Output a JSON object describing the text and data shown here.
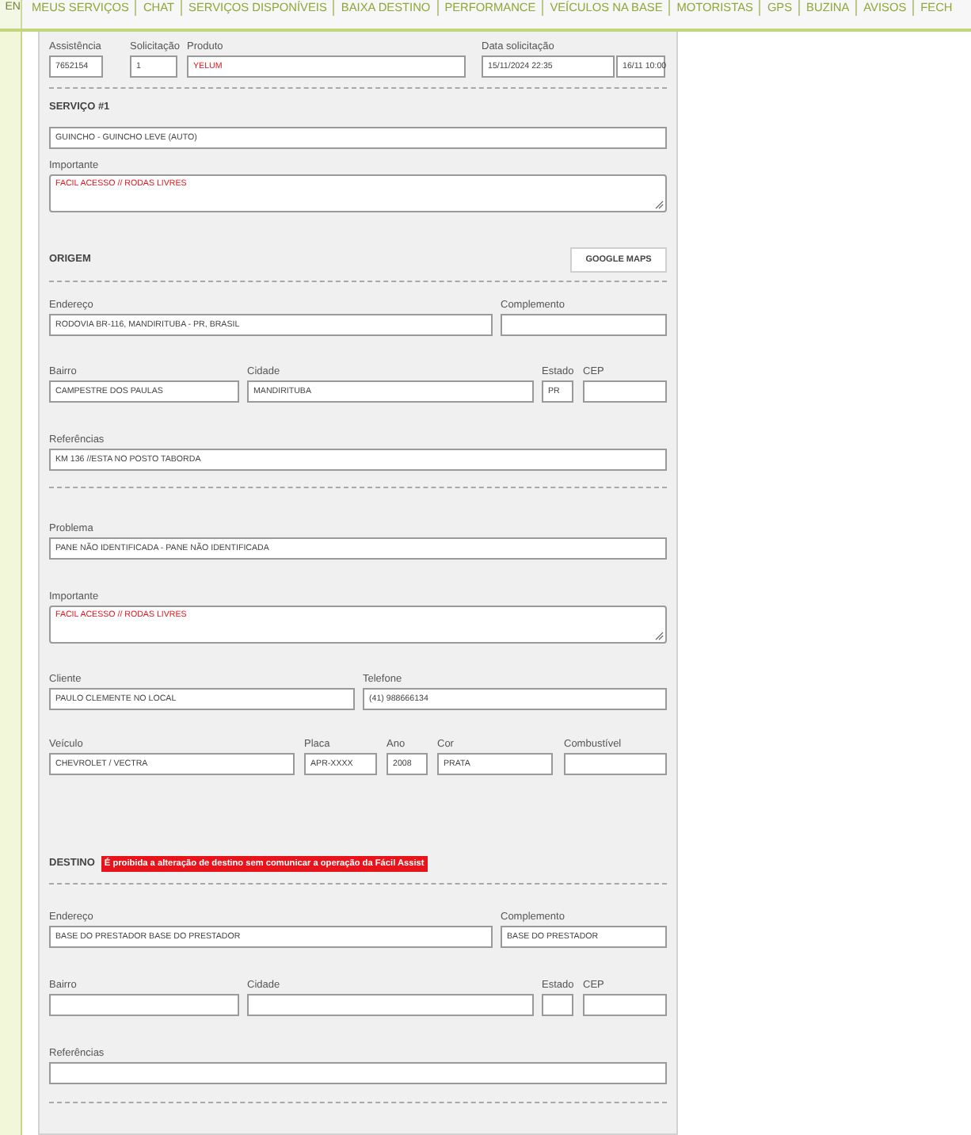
{
  "nav": {
    "language": "EN",
    "links": [
      "MEUS SERVIÇOS",
      "CHAT",
      "SERVIÇOS DISPONÍVEIS",
      "BAIXA DESTINO",
      "PERFORMANCE",
      "VEÍCULOS NA BASE",
      "MOTORISTAS",
      "GPS",
      "BUZINA",
      "AVISOS",
      "FECH"
    ]
  },
  "request": {
    "fields": [
      {
        "label": "Assistência",
        "value": "7652154",
        "alert": false
      },
      {
        "label": "Solicitação",
        "value": "1",
        "alert": false
      },
      {
        "label": "Produto",
        "value": "YELUM",
        "alert": true
      },
      {
        "label": "Data solicitação",
        "value": "15/11/2024 22:35",
        "alert": false
      },
      {
        "value": "16/11 10:00",
        "alert": false
      }
    ]
  },
  "service": {
    "title": "SERVIÇO #1",
    "value": "GUINCHO - GUINCHO LEVE (AUTO)",
    "important": {
      "label": "Importante",
      "value": "FACIL ACESSO // RODAS LIVRES",
      "alert": true
    }
  },
  "origin": {
    "title": "ORIGEM",
    "map_button": "GOOGLE MAPS",
    "address": {
      "label": "Endereço",
      "value": "RODOVIA BR-116, MANDIRITUBA - PR, BRASIL"
    },
    "complement": {
      "label": "Complemento"
    },
    "district": {
      "label": "Bairro",
      "value": "CAMPESTRE DOS PAULAS"
    },
    "city": {
      "label": "Cidade",
      "value": "MANDIRITUBA"
    },
    "state": {
      "label": "Estado",
      "value": "PR"
    },
    "zip": {
      "label": "CEP"
    },
    "reference": {
      "label": "Referências",
      "value": "KM 136 //ESTA NO POSTO TABORDA"
    }
  },
  "details": {
    "problem": {
      "label": "Problema",
      "value": "PANE NÃO IDENTIFICADA - PANE NÃO IDENTIFICADA"
    },
    "important": {
      "label": "Importante",
      "value": "FACIL ACESSO // RODAS LIVRES",
      "alert": true
    },
    "client": {
      "label": "Cliente",
      "value": "PAULO CLEMENTE  NO LOCAL"
    },
    "phone": {
      "label": "Telefone",
      "value": "(41) 988666134"
    },
    "vehicle": {
      "label": "Veículo",
      "value": "CHEVROLET / VECTRA"
    },
    "plate": {
      "label": "Placa",
      "value": "APR-XXXX"
    },
    "year": {
      "label": "Ano",
      "value": "2008"
    },
    "color": {
      "label": "Cor",
      "value": "PRATA"
    },
    "fuel": {
      "label": "Combustível"
    }
  },
  "destination": {
    "title": "DESTINO",
    "warning": "É proibida a alteração de destino sem comunicar a operação da Fácil Assist",
    "address": {
      "label": "Endereço",
      "value": "BASE DO PRESTADOR BASE DO PRESTADOR"
    },
    "complement": {
      "label": "Complemento",
      "value": "BASE DO PRESTADOR"
    },
    "district": {
      "label": "Bairro"
    },
    "city": {
      "label": "Cidade"
    },
    "state": {
      "label": "Estado"
    },
    "zip": {
      "label": "CEP"
    },
    "reference": {
      "label": "Referências"
    }
  }
}
